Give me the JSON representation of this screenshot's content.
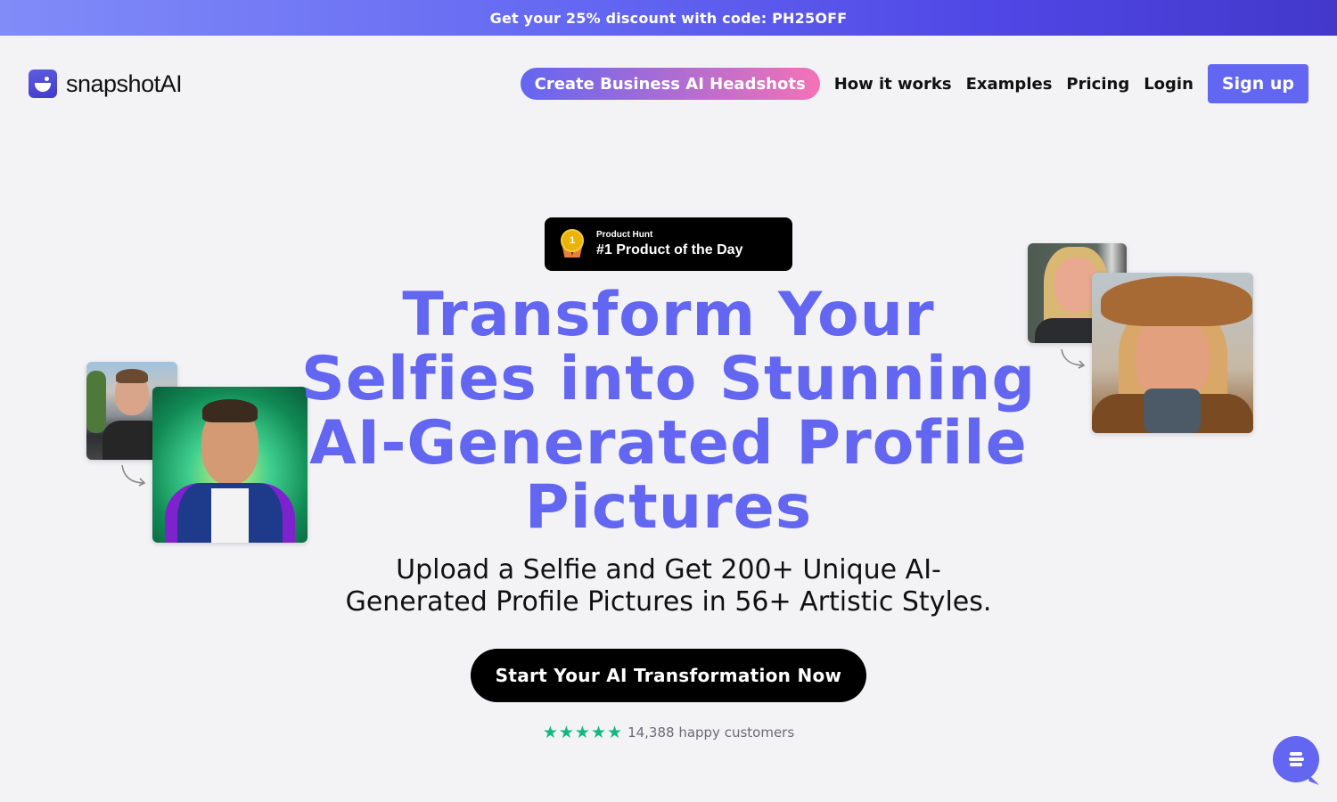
{
  "promo": {
    "text": "Get your 25% discount with code: PH25OFF"
  },
  "header": {
    "logo_text": "snapshotAI",
    "nav": {
      "cta_label": "Create Business AI Headshots",
      "links": [
        "How it works",
        "Examples",
        "Pricing",
        "Login"
      ],
      "signup_label": "Sign up"
    }
  },
  "badge": {
    "source": "Product Hunt",
    "title": "#1 Product of the Day",
    "rank": "1"
  },
  "hero": {
    "title_lines": [
      "Transform Your",
      "Selfies into Stunning",
      "AI-Generated Profile",
      "Pictures"
    ],
    "subtitle_lines": [
      "Upload a Selfie and Get 200+ Unique AI-",
      "Generated Profile Pictures in 56+ Artistic Styles."
    ],
    "cta_label": "Start Your AI Transformation Now"
  },
  "rating": {
    "stars": 5,
    "text": "14,388 happy customers"
  },
  "examples": [
    {
      "before": "selfie of smiling man on street",
      "after": "AI portrait of man with neon green background"
    },
    {
      "before": "selfie of blonde woman indoors",
      "after": "AI portrait of woman in cowboy hat"
    }
  ],
  "colors": {
    "brand": "#6366f1",
    "star": "#10b981"
  }
}
